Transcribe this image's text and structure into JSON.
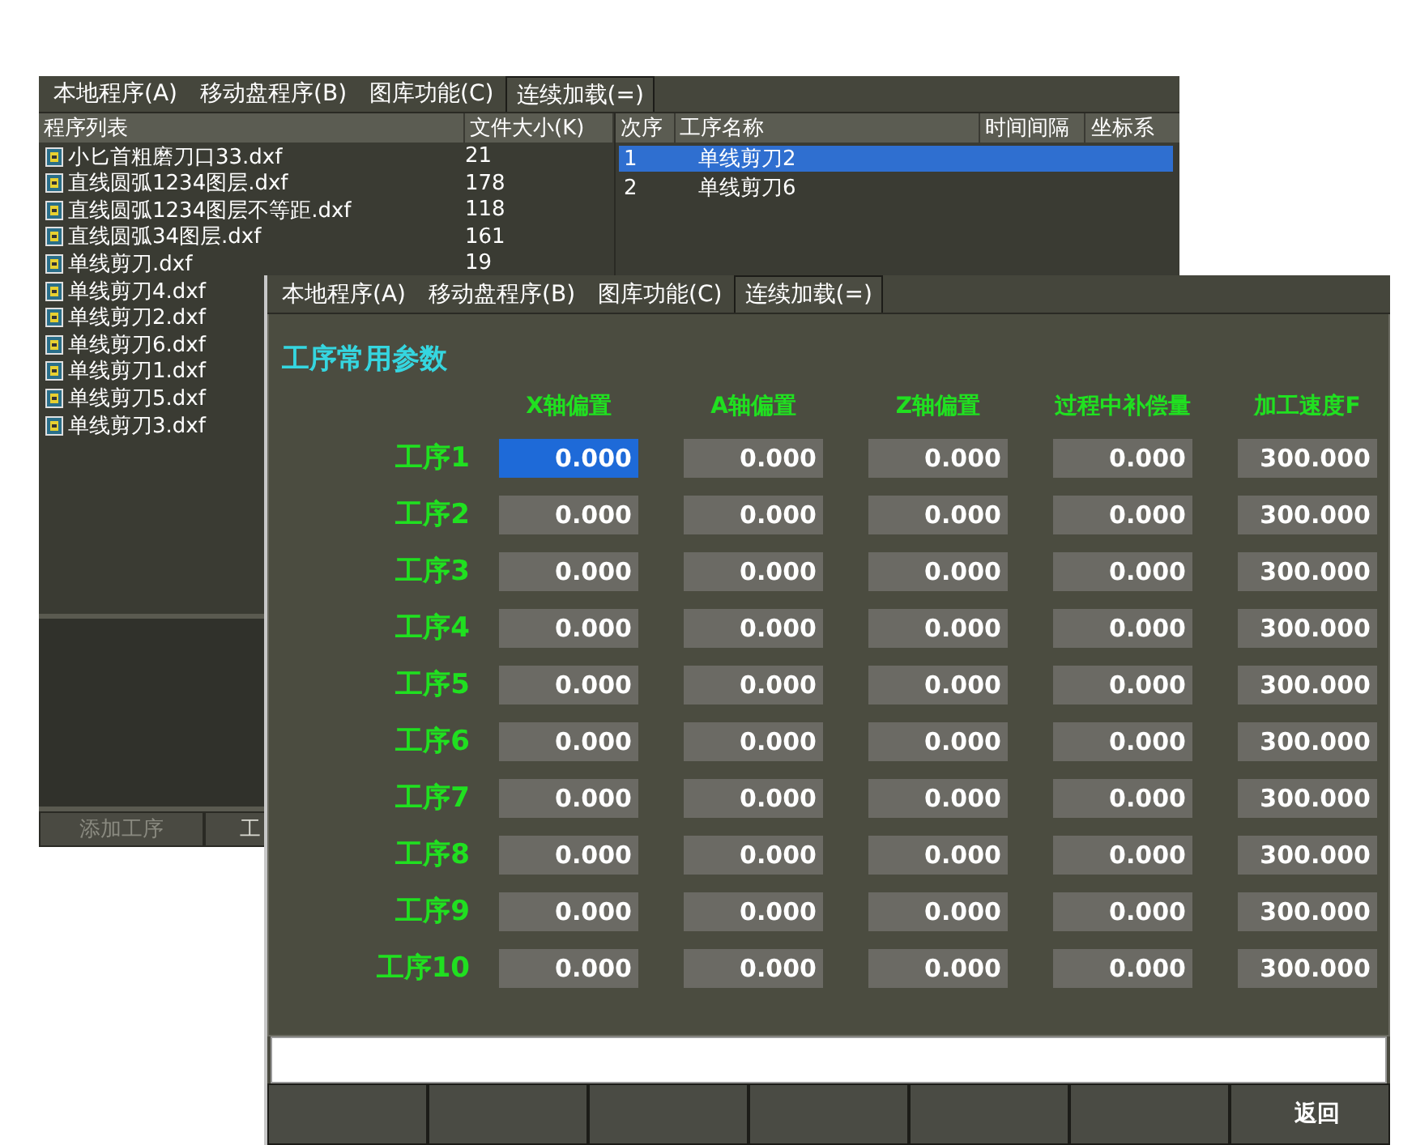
{
  "back_window": {
    "tabs": [
      {
        "label": "本地程序(A)",
        "selected": false
      },
      {
        "label": "移动盘程序(B)",
        "selected": false
      },
      {
        "label": "图库功能(C)",
        "selected": false
      },
      {
        "label": "连续加载(=)",
        "selected": true
      }
    ],
    "program_list": {
      "columns": [
        "程序列表",
        "文件大小(K)"
      ],
      "files": [
        {
          "name": "小匕首粗磨刀口33.dxf",
          "size": "21"
        },
        {
          "name": "直线圆弧1234图层.dxf",
          "size": "178"
        },
        {
          "name": "直线圆弧1234图层不等距.dxf",
          "size": "118"
        },
        {
          "name": "直线圆弧34图层.dxf",
          "size": "161"
        },
        {
          "name": "单线剪刀.dxf",
          "size": "19"
        },
        {
          "name": "单线剪刀4.dxf"
        },
        {
          "name": "单线剪刀2.dxf"
        },
        {
          "name": "单线剪刀6.dxf"
        },
        {
          "name": "单线剪刀1.dxf"
        },
        {
          "name": "单线剪刀5.dxf"
        },
        {
          "name": "单线剪刀3.dxf"
        }
      ]
    },
    "process_list": {
      "columns": [
        "次序",
        "工序名称",
        "时间间隔",
        "坐标系"
      ],
      "rows": [
        {
          "order": "1",
          "name": "单线剪刀2",
          "selected": true
        },
        {
          "order": "2",
          "name": "单线剪刀6",
          "selected": false
        }
      ]
    },
    "buttons": [
      "添加工序",
      "工"
    ]
  },
  "front_window": {
    "tabs": [
      {
        "label": "本地程序(A)",
        "selected": false
      },
      {
        "label": "移动盘程序(B)",
        "selected": false
      },
      {
        "label": "图库功能(C)",
        "selected": false
      },
      {
        "label": "连续加载(=)",
        "selected": true
      }
    ],
    "title": "工序常用参数",
    "columns": [
      "X轴偏置",
      "A轴偏置",
      "Z轴偏置",
      "过程中补偿量",
      "加工速度F"
    ],
    "rows": [
      {
        "label": "工序1",
        "values": [
          {
            "value": "0.000",
            "selected": true
          },
          {
            "value": "0.000",
            "selected": false
          },
          {
            "value": "0.000",
            "selected": false
          },
          {
            "value": "0.000",
            "selected": false
          },
          {
            "value": "300.000",
            "selected": false
          }
        ]
      },
      {
        "label": "工序2",
        "values": [
          {
            "value": "0.000",
            "selected": false
          },
          {
            "value": "0.000",
            "selected": false
          },
          {
            "value": "0.000",
            "selected": false
          },
          {
            "value": "0.000",
            "selected": false
          },
          {
            "value": "300.000",
            "selected": false
          }
        ]
      },
      {
        "label": "工序3",
        "values": [
          {
            "value": "0.000",
            "selected": false
          },
          {
            "value": "0.000",
            "selected": false
          },
          {
            "value": "0.000",
            "selected": false
          },
          {
            "value": "0.000",
            "selected": false
          },
          {
            "value": "300.000",
            "selected": false
          }
        ]
      },
      {
        "label": "工序4",
        "values": [
          {
            "value": "0.000",
            "selected": false
          },
          {
            "value": "0.000",
            "selected": false
          },
          {
            "value": "0.000",
            "selected": false
          },
          {
            "value": "0.000",
            "selected": false
          },
          {
            "value": "300.000",
            "selected": false
          }
        ]
      },
      {
        "label": "工序5",
        "values": [
          {
            "value": "0.000",
            "selected": false
          },
          {
            "value": "0.000",
            "selected": false
          },
          {
            "value": "0.000",
            "selected": false
          },
          {
            "value": "0.000",
            "selected": false
          },
          {
            "value": "300.000",
            "selected": false
          }
        ]
      },
      {
        "label": "工序6",
        "values": [
          {
            "value": "0.000",
            "selected": false
          },
          {
            "value": "0.000",
            "selected": false
          },
          {
            "value": "0.000",
            "selected": false
          },
          {
            "value": "0.000",
            "selected": false
          },
          {
            "value": "300.000",
            "selected": false
          }
        ]
      },
      {
        "label": "工序7",
        "values": [
          {
            "value": "0.000",
            "selected": false
          },
          {
            "value": "0.000",
            "selected": false
          },
          {
            "value": "0.000",
            "selected": false
          },
          {
            "value": "0.000",
            "selected": false
          },
          {
            "value": "300.000",
            "selected": false
          }
        ]
      },
      {
        "label": "工序8",
        "values": [
          {
            "value": "0.000",
            "selected": false
          },
          {
            "value": "0.000",
            "selected": false
          },
          {
            "value": "0.000",
            "selected": false
          },
          {
            "value": "0.000",
            "selected": false
          },
          {
            "value": "300.000",
            "selected": false
          }
        ]
      },
      {
        "label": "工序9",
        "values": [
          {
            "value": "0.000",
            "selected": false
          },
          {
            "value": "0.000",
            "selected": false
          },
          {
            "value": "0.000",
            "selected": false
          },
          {
            "value": "0.000",
            "selected": false
          },
          {
            "value": "300.000",
            "selected": false
          }
        ]
      },
      {
        "label": "工序10",
        "values": [
          {
            "value": "0.000",
            "selected": false
          },
          {
            "value": "0.000",
            "selected": false
          },
          {
            "value": "0.000",
            "selected": false
          },
          {
            "value": "0.000",
            "selected": false
          },
          {
            "value": "300.000",
            "selected": false
          }
        ]
      }
    ],
    "buttons": [
      {
        "kind": "blank"
      },
      {
        "kind": "blank"
      },
      {
        "kind": "blank"
      },
      {
        "kind": "blank"
      },
      {
        "kind": "blank"
      },
      {
        "kind": "blank"
      },
      {
        "kind": "text",
        "label": "返回"
      }
    ]
  }
}
